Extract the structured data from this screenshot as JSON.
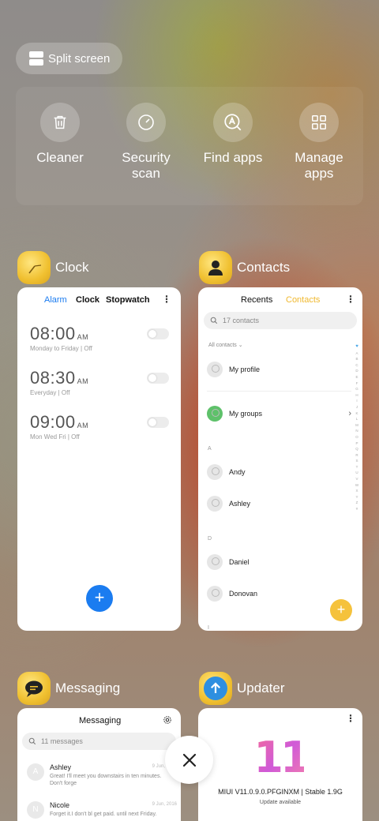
{
  "split_screen": {
    "label": "Split screen"
  },
  "tools": [
    {
      "label": "Cleaner",
      "icon": "trash-icon"
    },
    {
      "label": "Security scan",
      "icon": "speedometer-icon"
    },
    {
      "label": "Find apps",
      "icon": "search-app-icon"
    },
    {
      "label": "Manage apps",
      "icon": "grid-icon"
    }
  ],
  "clock": {
    "app_name": "Clock",
    "tabs": [
      "Alarm",
      "Clock",
      "Stopwatch"
    ],
    "alarms": [
      {
        "time": "08:00",
        "ampm": "AM",
        "days": "Monday to Friday",
        "state": "Off"
      },
      {
        "time": "08:30",
        "ampm": "AM",
        "days": "Everyday",
        "state": "Off"
      },
      {
        "time": "09:00",
        "ampm": "AM",
        "days": "Mon Wed Fri",
        "state": "Off"
      }
    ],
    "fab": "+"
  },
  "contacts": {
    "app_name": "Contacts",
    "tabs": [
      "Recents",
      "Contacts"
    ],
    "search_placeholder": "17 contacts",
    "filter": "All contacts",
    "my_profile": "My profile",
    "my_groups": "My groups",
    "section_a": "A",
    "andy": "Andy",
    "ashley": "Ashley",
    "section_d": "D",
    "daniel": "Daniel",
    "donovan": "Donovan",
    "next_section": "I",
    "alphabet": [
      "A",
      "B",
      "C",
      "D",
      "E",
      "F",
      "G",
      "H",
      "I",
      "J",
      "K",
      "L",
      "M",
      "N",
      "O",
      "P",
      "Q",
      "R",
      "S",
      "T",
      "U",
      "V",
      "W",
      "X",
      "Y",
      "Z",
      "#"
    ],
    "fab": "+"
  },
  "messaging": {
    "app_name": "Messaging",
    "title": "Messaging",
    "search_placeholder": "11 messages",
    "threads": [
      {
        "initial": "A",
        "name": "Ashley",
        "text1": "Great! I'll meet you downstairs in ten minutes.",
        "text2": "Don't forge",
        "date": "9 Jun, 2016"
      },
      {
        "initial": "N",
        "name": "Nicole",
        "text1": "Forget it.I don't bl get paid. until next Friday.",
        "date": "9 Jun, 2016"
      }
    ]
  },
  "updater": {
    "app_name": "Updater",
    "version": "MIUI V11.0.9.0.PFGINXM | Stable 1.9G",
    "status": "Update available",
    "logo_text": "11"
  },
  "colors": {
    "blue": "#1b7cf0",
    "yellow": "#f5c23c",
    "contacts_accent": "#f0b82e"
  }
}
